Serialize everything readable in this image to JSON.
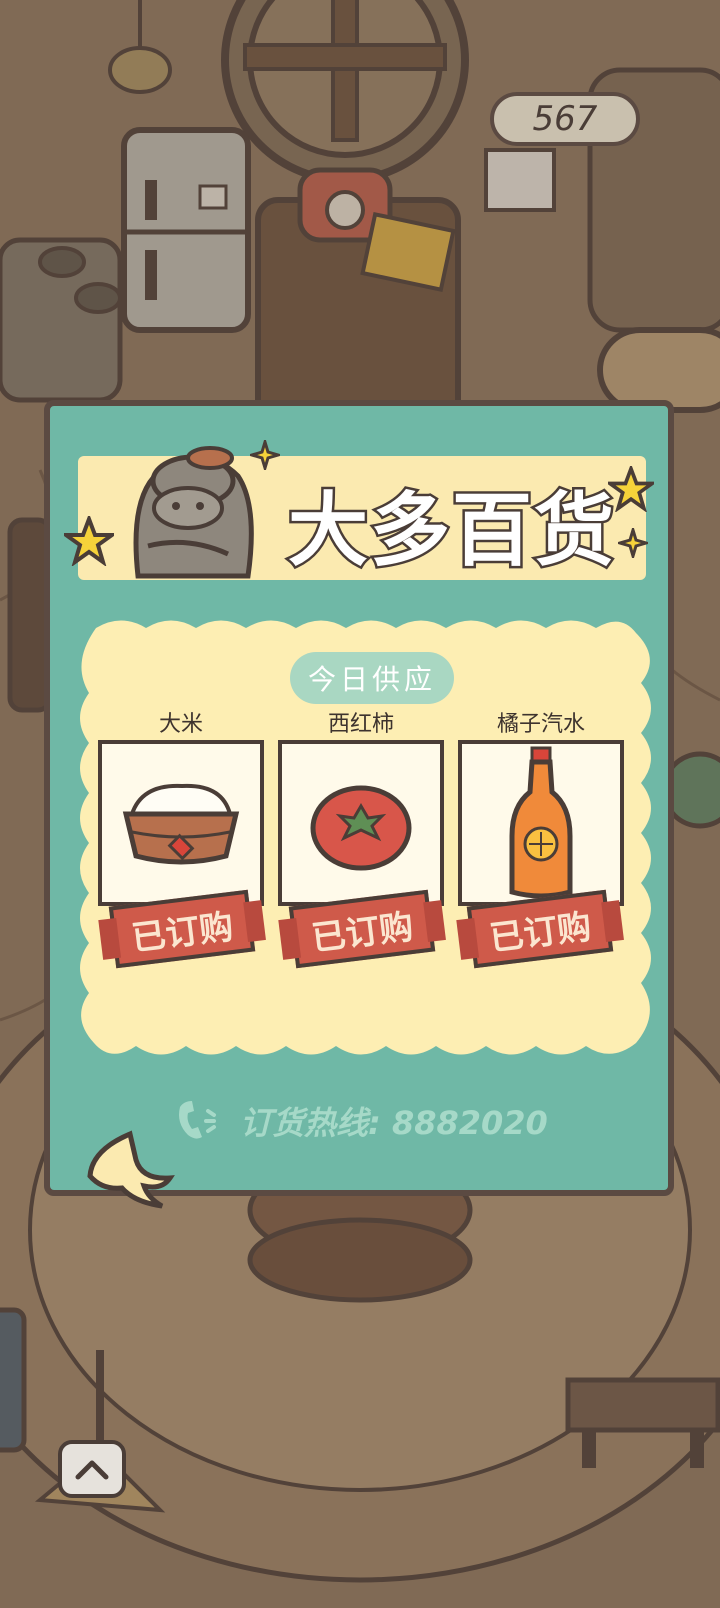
{
  "coins": "567",
  "shop": {
    "title": "大多百货",
    "section_label": "今日供应",
    "items": [
      {
        "name": "大米",
        "icon": "rice-bowl-icon",
        "status": "已订购"
      },
      {
        "name": "西红柿",
        "icon": "tomato-icon",
        "status": "已订购"
      },
      {
        "name": "橘子汽水",
        "icon": "orange-soda-icon",
        "status": "已订购"
      }
    ],
    "hotline": "订货热线: 8882020"
  },
  "colors": {
    "panel": "#6fb8a6",
    "banner": "#fbeab0",
    "card": "#fdeeb3",
    "badge": "#cf5a4a",
    "outline": "#4a3d37"
  }
}
